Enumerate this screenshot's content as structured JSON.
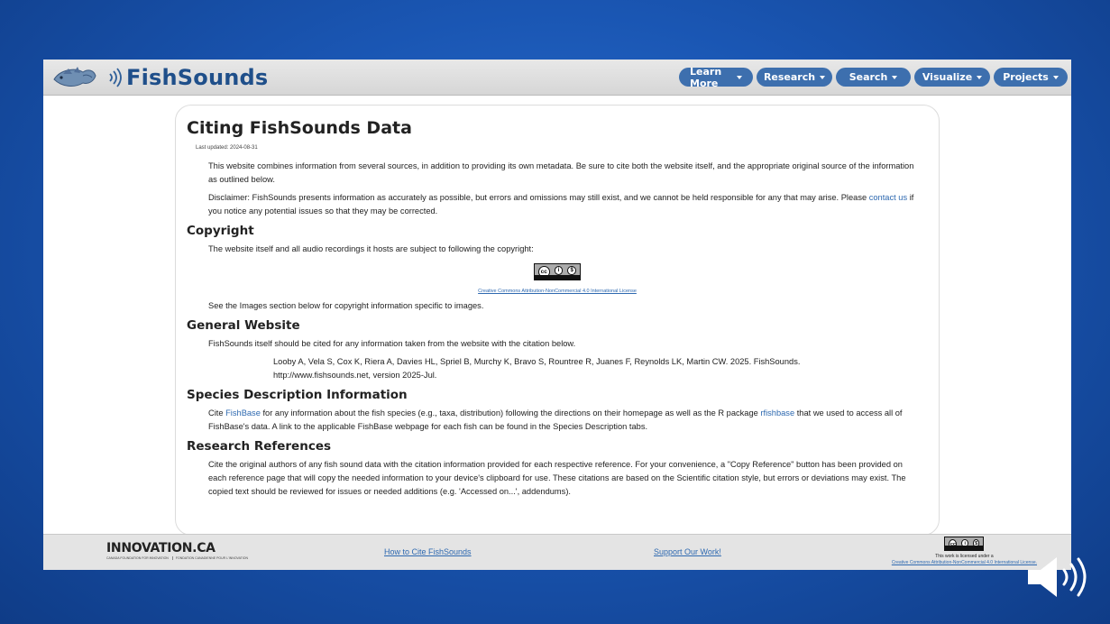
{
  "header": {
    "logo_text": "FishSounds",
    "nav": [
      {
        "label": "Learn More"
      },
      {
        "label": "Research"
      },
      {
        "label": "Search"
      },
      {
        "label": "Visualize"
      },
      {
        "label": "Projects"
      }
    ]
  },
  "page": {
    "title": "Citing FishSounds Data",
    "updated": "Last updated: 2024-08-31",
    "intro": "This website combines information from several sources, in addition to providing its own metadata. Be sure to cite both the website itself, and the appropriate original source of the information as outlined below.",
    "disclaimer_pre": "Disclaimer: FishSounds presents information as accurately as possible, but errors and omissions may still exist, and we cannot be held responsible for any that may arise. Please ",
    "disclaimer_link": "contact us",
    "disclaimer_post": " if you notice any potential issues so that they may be corrected.",
    "sections": {
      "copyright": {
        "heading": "Copyright",
        "text": "The website itself and all audio recordings it hosts are subject to following the copyright:",
        "badge": {
          "cc": "cc",
          "by": "BY",
          "nc": "NC"
        },
        "license_caption": "Creative Commons Attribution-NonCommercial 4.0 International License",
        "note": "See the Images section below for copyright information specific to images."
      },
      "general": {
        "heading": "General Website",
        "text": "FishSounds itself should be cited for any information taken from the website with the citation below.",
        "citation_line1": "Looby A, Vela S, Cox K, Riera A, Davies HL, Spriel B, Murchy K, Bravo S, Rountree R, Juanes F, Reynolds LK, Martin CW. 2025. FishSounds.",
        "citation_line2": "http://www.fishsounds.net, version 2025-Jul."
      },
      "species": {
        "heading": "Species Description Information",
        "text_pre": "Cite ",
        "link1": "FishBase",
        "text_mid": " for any information about the fish species (e.g., taxa, distribution) following the directions on their homepage as well as the R package ",
        "link2": "rfishbase",
        "text_post": " that we used to access all of FishBase's data. A link to the applicable FishBase webpage for each fish can be found in the Species Description tabs."
      },
      "research": {
        "heading": "Research References",
        "text": "Cite the original authors of any fish sound data with the citation information provided for each respective reference. For your convenience, a \"Copy Reference\" button has been provided on each reference page that will copy the needed information to your device's clipboard for use. These citations are based on the Scientific citation style, but errors or deviations may exist. The copied text should be reviewed for issues or needed additions (e.g. 'Accessed on...', addendums)."
      }
    }
  },
  "footer": {
    "sponsor_name": "INNOVATION.CA",
    "sponsor_sub_en": "CANADA FOUNDATION FOR INNOVATION",
    "sponsor_sub_fr": "FONDATION CANADIENNE POUR L'INNOVATION",
    "link_cite": "How to Cite FishSounds",
    "link_support": "Support Our Work!",
    "license_line1": "This work is licensed under a",
    "license_line2": "Creative Commons Attribution-NonCommercial 4.0 International License."
  },
  "colors": {
    "nav_button": "#3d6fae",
    "link": "#2e69b0",
    "logo": "#1f4f8a",
    "background": "#1a56b3"
  },
  "icons": [
    "fish-logo-icon",
    "sound-wave-icon",
    "chevron-down-icon",
    "speaker-icon"
  ]
}
